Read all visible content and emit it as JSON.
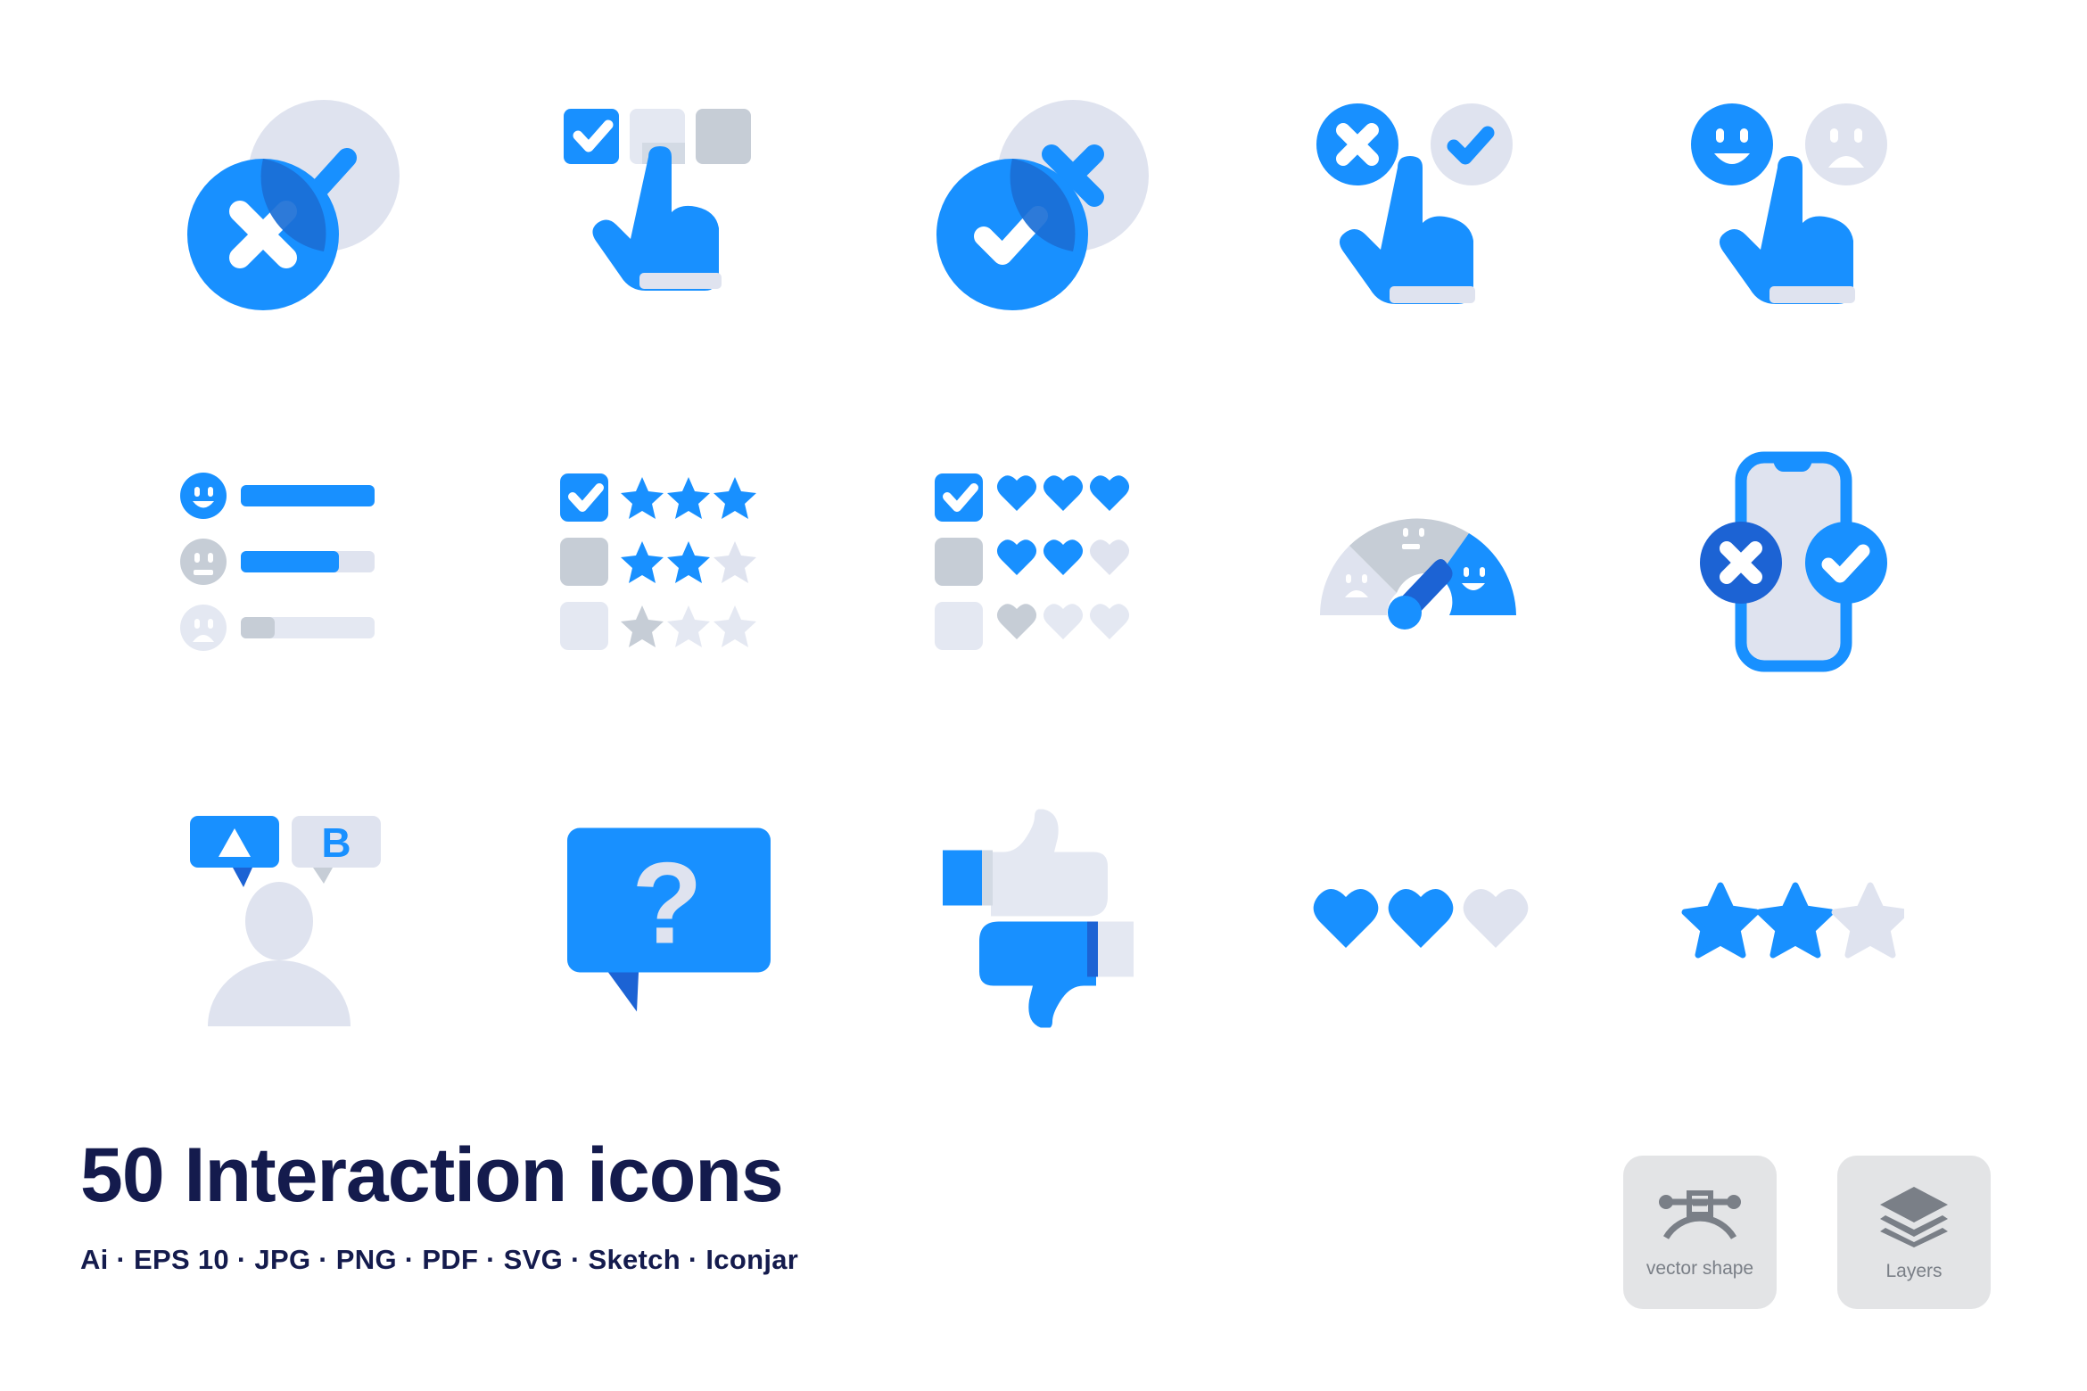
{
  "page": {
    "background": "#FFFFFF",
    "title": "50 Interaction icons",
    "formats_line": "Ai ·  EPS 10 · JPG · PNG · PDF · SVG · Sketch · Iconjar",
    "formats": [
      "Ai",
      "EPS 10",
      "JPG",
      "PNG",
      "PDF",
      "SVG",
      "Sketch",
      "Iconjar"
    ],
    "count": "50",
    "set_name": "Interaction icons"
  },
  "colors": {
    "blue": "#1890FF",
    "blue_dark": "#1B6FD6",
    "blue_deep": "#1C63D4",
    "navy": "#141B4D",
    "gray_light": "#DFE3EF",
    "gray_mid": "#C6CDD6",
    "gray_pale": "#E4E8F2",
    "badge_bg": "#E3E4E6",
    "badge_icon": "#7A7F87",
    "white": "#FFFFFF"
  },
  "icons": [
    {
      "id": "overlap-cross-check",
      "name": "Overlapping circles cross and check",
      "row": 1,
      "col": 1,
      "elements": [
        "light-circle-check",
        "blue-circle-cross",
        "overlap-region"
      ]
    },
    {
      "id": "checkbox-select-hand",
      "name": "Hand selecting checkbox option",
      "row": 1,
      "col": 2,
      "elements": [
        "checkbox-checked",
        "checkbox-hover",
        "checkbox-empty",
        "pointing-hand"
      ]
    },
    {
      "id": "overlap-check-cross",
      "name": "Overlapping circles check and cross",
      "row": 1,
      "col": 3,
      "elements": [
        "light-circle-cross",
        "blue-circle-check",
        "overlap-region"
      ]
    },
    {
      "id": "choose-yes-no-hand",
      "name": "Hand choosing between cross and check",
      "row": 1,
      "col": 4,
      "elements": [
        "blue-circle-cross",
        "light-circle-check",
        "pointing-hand"
      ]
    },
    {
      "id": "choose-mood-hand",
      "name": "Hand choosing between happy and sad face",
      "row": 1,
      "col": 5,
      "elements": [
        "happy-face",
        "sad-face",
        "pointing-hand"
      ]
    },
    {
      "id": "satisfaction-bars",
      "name": "Satisfaction rating bars",
      "row": 2,
      "col": 1,
      "rows": [
        {
          "face": "happy-face",
          "fill_percent": 100
        },
        {
          "face": "neutral-face",
          "fill_percent": 73
        },
        {
          "face": "sad-face",
          "fill_percent": 25
        }
      ]
    },
    {
      "id": "star-rating-list",
      "name": "Checkbox star rating list",
      "row": 2,
      "col": 2,
      "rows": [
        {
          "checkbox": "checked",
          "stars_filled": 3,
          "stars_total": 3
        },
        {
          "checkbox": "gray",
          "stars_filled": 2,
          "stars_total": 3
        },
        {
          "checkbox": "pale",
          "stars_filled": 0,
          "stars_total": 3
        }
      ]
    },
    {
      "id": "heart-rating-list",
      "name": "Checkbox heart rating list",
      "row": 2,
      "col": 3,
      "rows": [
        {
          "checkbox": "checked",
          "hearts_filled": 3,
          "hearts_total": 3
        },
        {
          "checkbox": "gray",
          "hearts_filled": 2,
          "hearts_total": 3
        },
        {
          "checkbox": "pale",
          "hearts_filled": 0,
          "hearts_total": 3
        }
      ]
    },
    {
      "id": "satisfaction-gauge",
      "name": "Customer satisfaction gauge",
      "row": 2,
      "col": 4,
      "segments": [
        "sad-pale",
        "neutral-gray",
        "happy-blue"
      ],
      "needle_points_to": "happy-blue"
    },
    {
      "id": "mobile-feedback",
      "name": "Mobile phone with accept and reject",
      "row": 2,
      "col": 5,
      "elements": [
        "phone-outline",
        "cross-circle",
        "check-circle"
      ]
    },
    {
      "id": "ab-testing-person",
      "name": "A B testing person with speech bubbles",
      "row": 3,
      "col": 1,
      "bubble_a": "A",
      "bubble_b": "B"
    },
    {
      "id": "question-bubble",
      "name": "Question mark speech bubble",
      "row": 3,
      "col": 2,
      "glyph": "?"
    },
    {
      "id": "thumbs-up-down",
      "name": "Thumbs up and thumbs down",
      "row": 3,
      "col": 3,
      "elements": [
        "thumb-up",
        "thumb-down"
      ]
    },
    {
      "id": "heart-rating",
      "name": "Three heart rating",
      "row": 3,
      "col": 4,
      "filled": 2,
      "total": 3
    },
    {
      "id": "star-rating",
      "name": "Three star rating",
      "row": 3,
      "col": 5,
      "filled": 2,
      "total": 3
    }
  ],
  "badges": [
    {
      "id": "vector-shape",
      "label": "vector shape",
      "icon": "bezier-pen-icon"
    },
    {
      "id": "layers",
      "label": "Layers",
      "icon": "layers-stack-icon"
    }
  ]
}
